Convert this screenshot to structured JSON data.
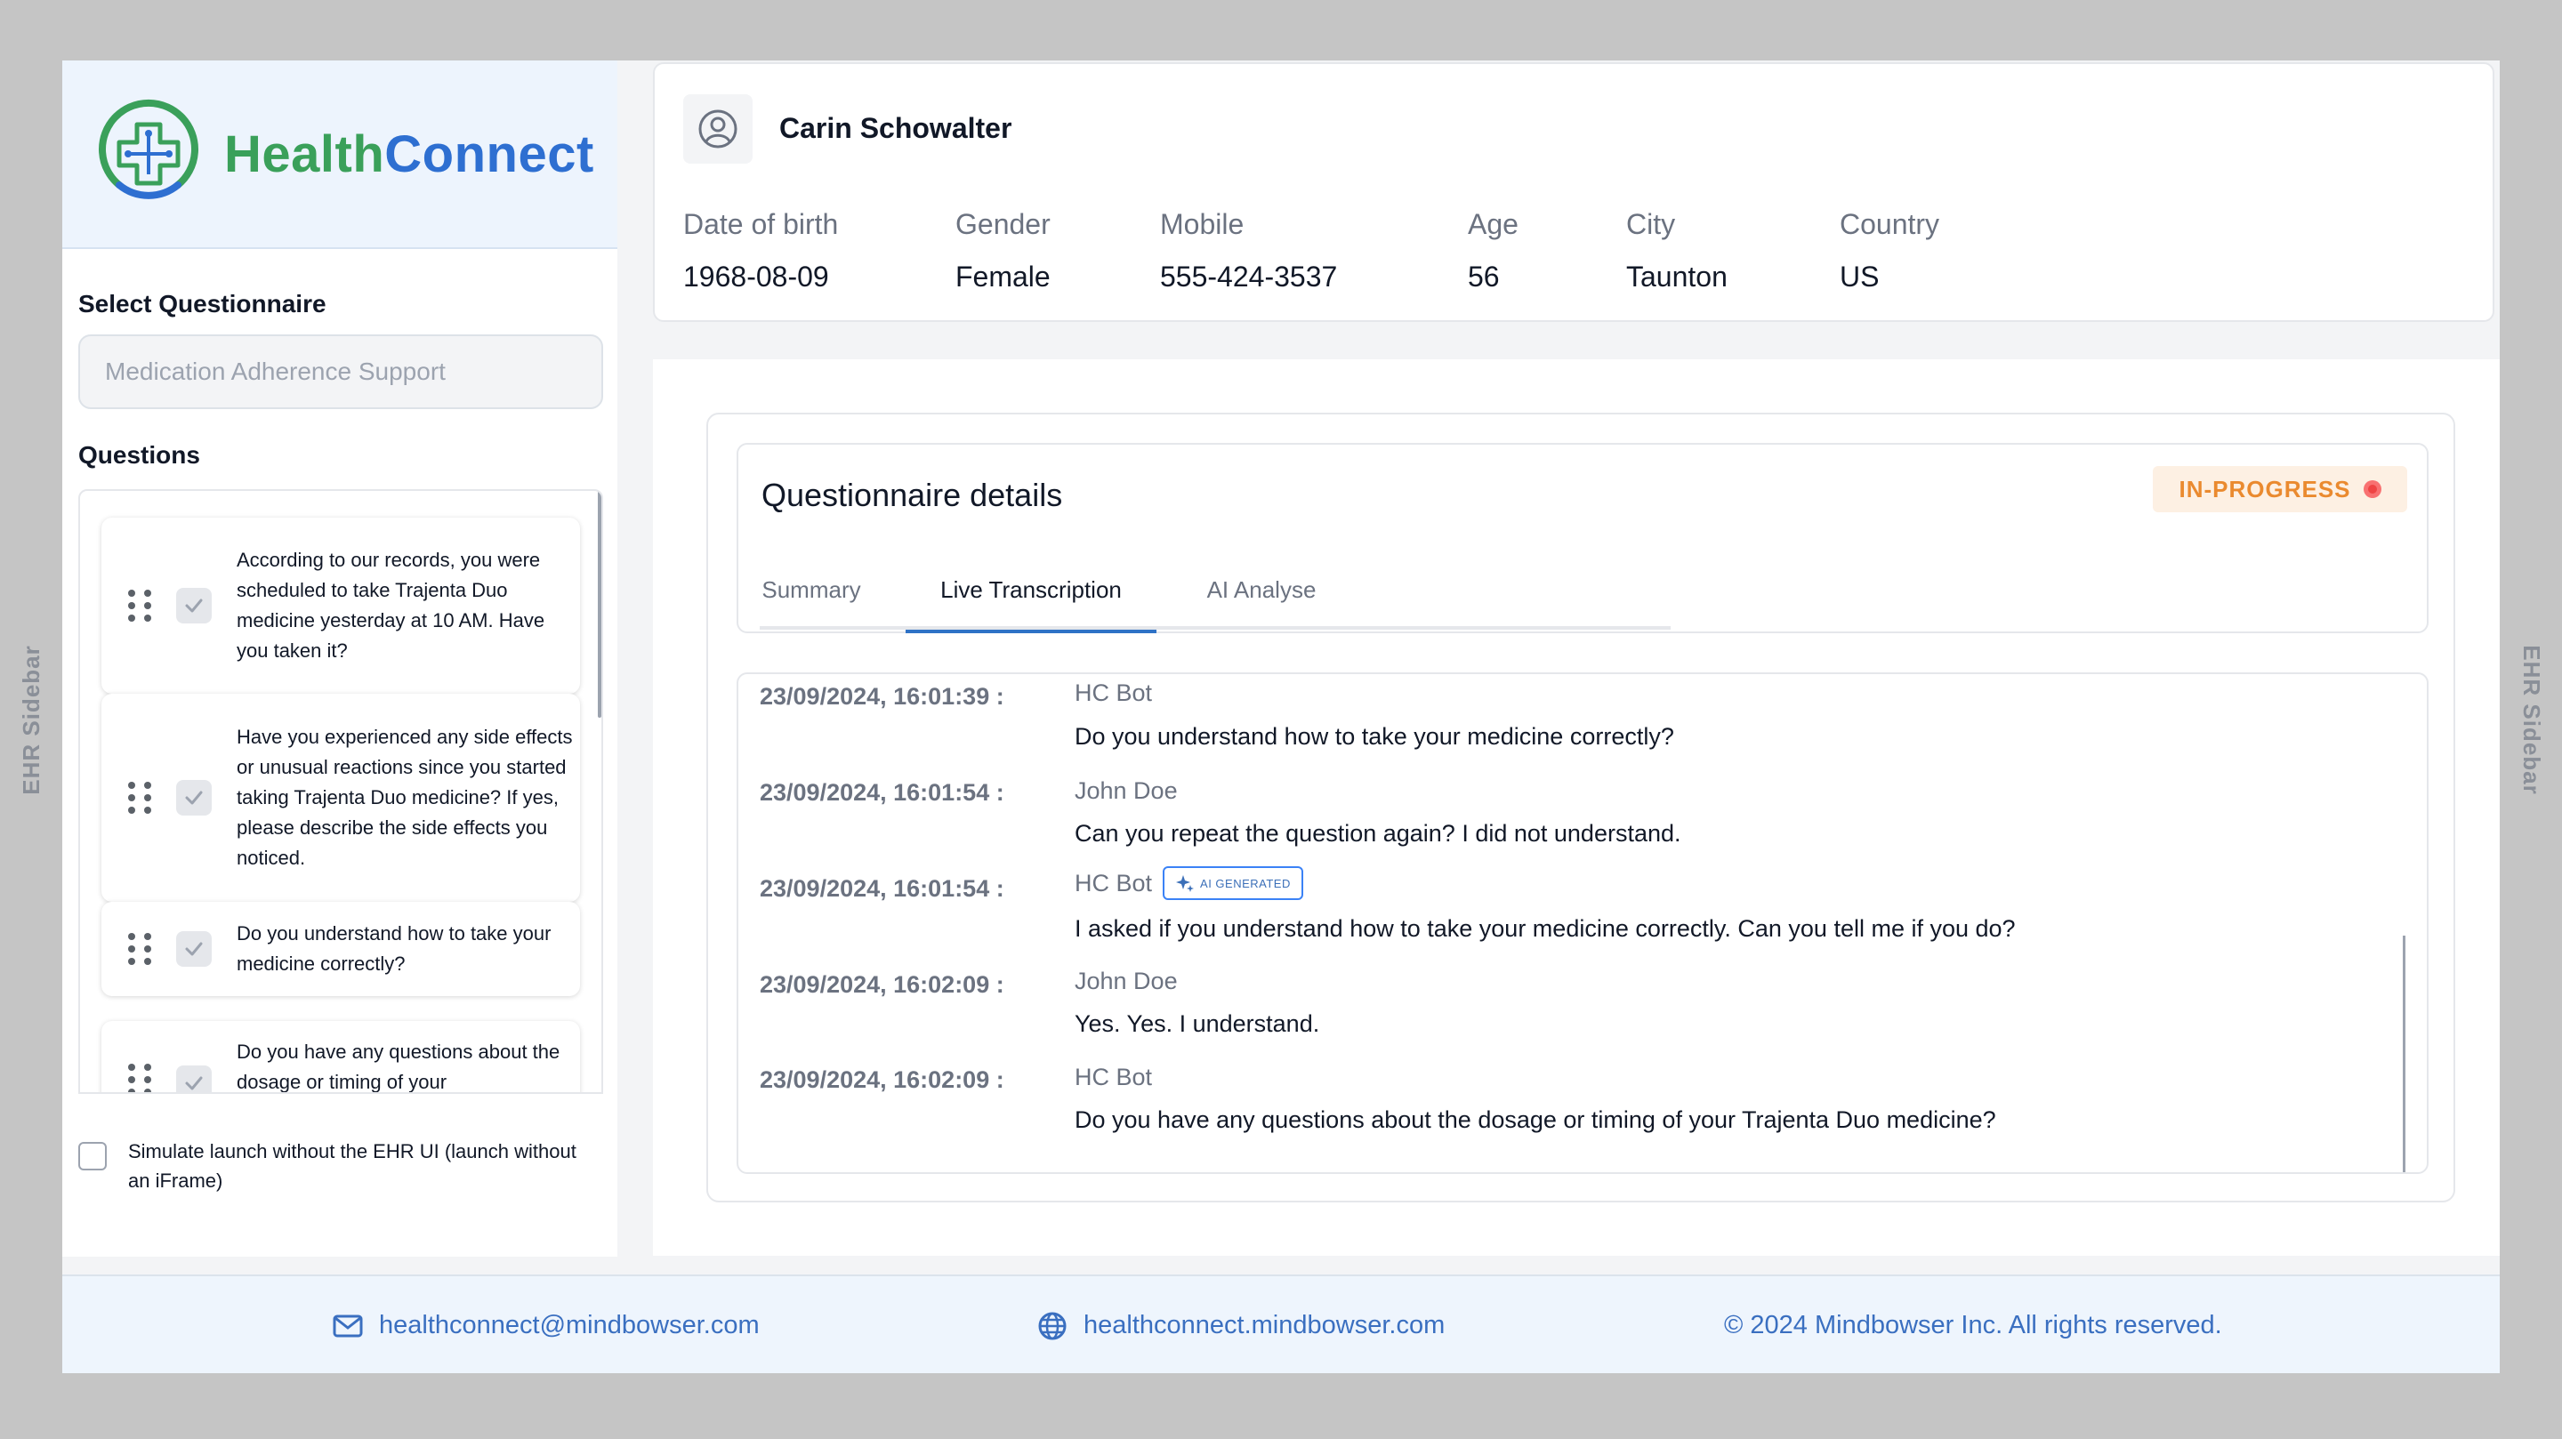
{
  "ehr": {
    "left_label": "EHR Sidebar",
    "right_label": "EHR Sidebar"
  },
  "logo": {
    "part1": "Health",
    "part2": "Connect"
  },
  "sidebar": {
    "select_label": "Select Questionnaire",
    "select_placeholder": "Medication Adherence Support",
    "questions_label": "Questions",
    "questions": [
      {
        "text": "According to our records, you were scheduled to take Trajenta Duo medicine yesterday at 10 AM. Have you taken it?",
        "checked": true
      },
      {
        "text": "Have you experienced any side effects or unusual reactions since you started taking Trajenta Duo medicine? If yes, please describe the side effects you noticed.",
        "checked": true
      },
      {
        "text": "Do you understand how to take your medicine correctly?",
        "checked": true
      },
      {
        "text": "Do you have any questions about the dosage or timing of your",
        "checked": true
      }
    ],
    "simulate_label": "Simulate launch without the EHR UI (launch without an iFrame)"
  },
  "patient": {
    "name": "Carin Schowalter",
    "fields": [
      {
        "label": "Date of birth",
        "value": "1968-08-09"
      },
      {
        "label": "Gender",
        "value": "Female"
      },
      {
        "label": "Mobile",
        "value": "555-424-3537"
      },
      {
        "label": "Age",
        "value": "56"
      },
      {
        "label": "City",
        "value": "Taunton"
      },
      {
        "label": "Country",
        "value": "US"
      }
    ]
  },
  "questionnaire": {
    "title": "Questionnaire details",
    "status": "IN-PROGRESS",
    "status_color": "#ea8a2f",
    "tabs": [
      "Summary",
      "Live Transcription",
      "AI Analyse"
    ],
    "active_tab": "Live Transcription",
    "ai_badge": "AI GENERATED",
    "messages": [
      {
        "time": "23/09/2024, 16:01:39 :",
        "sender": "HC Bot",
        "text": "Do you understand how to take your medicine correctly?",
        "ai": false
      },
      {
        "time": "23/09/2024, 16:01:54 :",
        "sender": "John Doe",
        "text": "Can you repeat the question again? I did not understand.",
        "ai": false
      },
      {
        "time": "23/09/2024, 16:01:54 :",
        "sender": "HC Bot",
        "text": "I asked if you understand how to take your medicine correctly. Can you tell me if you do?",
        "ai": true
      },
      {
        "time": "23/09/2024, 16:02:09 :",
        "sender": "John Doe",
        "text": "Yes. Yes. I understand.",
        "ai": false
      },
      {
        "time": "23/09/2024, 16:02:09 :",
        "sender": "HC Bot",
        "text": "Do you have any questions about the dosage or timing of your Trajenta Duo medicine?",
        "ai": false
      }
    ]
  },
  "footer": {
    "email": "healthconnect@mindbowser.com",
    "website": "healthconnect.mindbowser.com",
    "copyright": "© 2024 Mindbowser Inc. All rights reserved."
  },
  "colors": {
    "brand_green": "#3aa05a",
    "brand_blue": "#2e6fd1",
    "accent": "#2f72c6"
  }
}
